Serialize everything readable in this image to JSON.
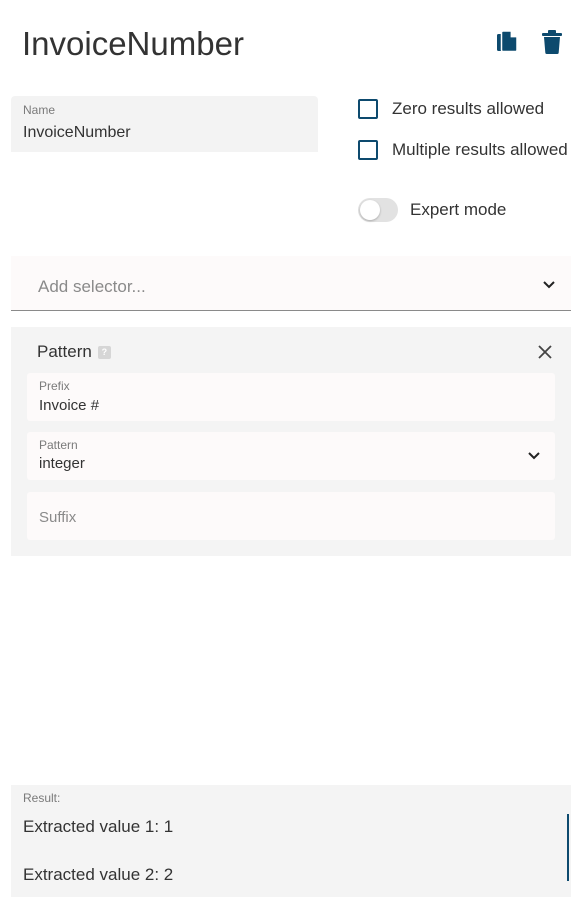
{
  "header": {
    "title": "InvoiceNumber",
    "copy_icon": "copy-icon",
    "delete_icon": "trash-icon"
  },
  "name_field": {
    "label": "Name",
    "value": "InvoiceNumber"
  },
  "options": {
    "zero_results": {
      "label": "Zero results allowed",
      "checked": false
    },
    "multiple_results": {
      "label": "Multiple results allowed",
      "checked": false
    },
    "expert_mode": {
      "label": "Expert mode",
      "on": false
    }
  },
  "selector": {
    "placeholder": "Add selector...",
    "icon": "chevron-down-icon"
  },
  "pattern_card": {
    "title": "Pattern",
    "help_icon": "?",
    "close_icon": "close-icon",
    "prefix": {
      "label": "Prefix",
      "value": "Invoice #"
    },
    "pattern": {
      "label": "Pattern",
      "value": "integer"
    },
    "suffix": {
      "placeholder": "Suffix"
    }
  },
  "result": {
    "label": "Result:",
    "lines": [
      "Extracted value 1: 1",
      "Extracted value 2: 2"
    ]
  },
  "colors": {
    "accent": "#0d4a6e",
    "field_bg": "#f3f3f3",
    "card_bg": "#f4f4f4",
    "toggle_off": "#e2e2e2"
  }
}
